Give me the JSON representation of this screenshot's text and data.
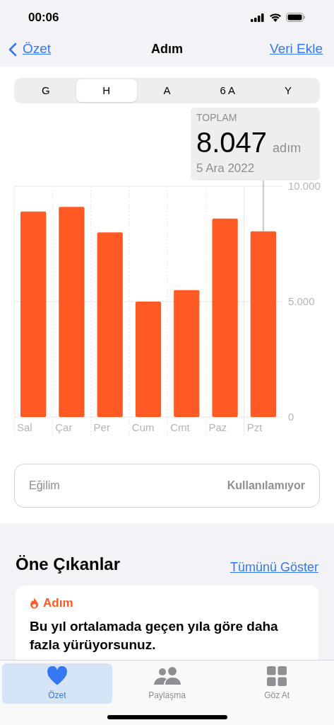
{
  "status_bar": {
    "time": "00:06"
  },
  "nav": {
    "back": "Özet",
    "title": "Adım",
    "action": "Veri Ekle"
  },
  "segments": [
    {
      "label": "G",
      "selected": false
    },
    {
      "label": "H",
      "selected": true
    },
    {
      "label": "A",
      "selected": false
    },
    {
      "label": "6 A",
      "selected": false
    },
    {
      "label": "Y",
      "selected": false
    }
  ],
  "summary": {
    "label": "TOPLAM",
    "value": "8.047",
    "unit": "adım",
    "date": "5 Ara 2022"
  },
  "chart_data": {
    "type": "bar",
    "categories": [
      "Sal",
      "Çar",
      "Per",
      "Cum",
      "Cmt",
      "Paz",
      "Pzt"
    ],
    "series": [
      {
        "color": "#ff5a24",
        "values": [
          8900,
          9100,
          8000,
          5000,
          5500,
          8600,
          8047
        ]
      }
    ],
    "ylim": [
      0,
      10000
    ],
    "yticks": [
      {
        "value": 0,
        "label": "0"
      },
      {
        "value": 5000,
        "label": "5.000"
      },
      {
        "value": 10000,
        "label": "10.000"
      }
    ],
    "annotations": [
      {
        "x": "Pzt"
      }
    ]
  },
  "trend": {
    "label": "Eğilim",
    "value": "Kullanılamıyor"
  },
  "highlights": {
    "title": "Öne Çıkanlar",
    "link": "Tümünü Göster",
    "card": {
      "category": "Adım",
      "text": "Bu yıl ortalamada geçen yıla göre daha fazla yürüyorsunuz."
    }
  },
  "tab_bar": [
    {
      "label": "Özet",
      "kind": "heart",
      "selected": true
    },
    {
      "label": "Paylaşma",
      "kind": "people",
      "selected": false
    },
    {
      "label": "Göz At",
      "kind": "grid",
      "selected": false
    }
  ]
}
